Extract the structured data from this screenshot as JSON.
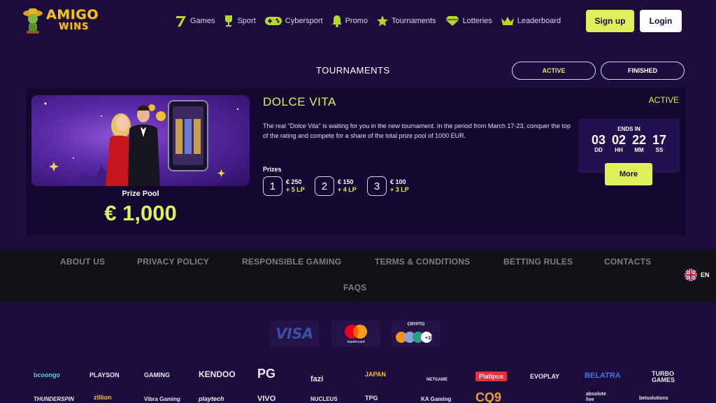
{
  "brand": {
    "logo_top": "AMIGO",
    "logo_bottom": "WINS"
  },
  "nav": [
    {
      "label": "Games",
      "icon": "seven-icon"
    },
    {
      "label": "Sport",
      "icon": "trophy-icon"
    },
    {
      "label": "Cybersport",
      "icon": "gamepad-icon"
    },
    {
      "label": "Promo",
      "icon": "bell-icon"
    },
    {
      "label": "Tournaments",
      "icon": "star-icon"
    },
    {
      "label": "Lotteries",
      "icon": "diamond-icon"
    },
    {
      "label": "Leaderboard",
      "icon": "crown-icon"
    }
  ],
  "auth": {
    "signup": "Sign up",
    "login": "Login"
  },
  "tournaments": {
    "title": "TOURNAMENTS",
    "filters": {
      "active": "ACTIVE",
      "finished": "FINISHED"
    }
  },
  "tournament": {
    "name": "DOLCE VITA",
    "status": "ACTIVE",
    "description": "The real \"Dolce Vita\" is waiting for you in the new tournament. In the period from March 17-23, conquer the top of the rating and compete for a share of the total prize pool of 1000 EUR.",
    "prize_pool_label": "Prize Pool",
    "prize_pool": "€ 1,000",
    "prizes_label": "Prizes",
    "prizes": [
      {
        "rank": "1",
        "amount": "€ 250",
        "lp": "+ 5 LP"
      },
      {
        "rank": "2",
        "amount": "€ 150",
        "lp": "+ 4 LP"
      },
      {
        "rank": "3",
        "amount": "€ 100",
        "lp": "+ 3 LP"
      }
    ],
    "ends_label": "ENDS IN",
    "countdown": [
      {
        "value": "03",
        "unit": "DD"
      },
      {
        "value": "02",
        "unit": "HH"
      },
      {
        "value": "22",
        "unit": "MM"
      },
      {
        "value": "17",
        "unit": "SS"
      }
    ],
    "more": "More"
  },
  "footer": {
    "links": {
      "about": "ABOUT US",
      "privacy": "PRIVACY POLICY",
      "responsible": "RESPONSIBLE GAMING",
      "terms": "TERMS & CONDITIONS",
      "betting": "BETTING RULES",
      "contacts": "CONTACTS",
      "faqs": "FAQS"
    },
    "language": "EN"
  },
  "payments": {
    "visa": "VISA",
    "mastercard": "mastercard",
    "crypto": "CRYPTO",
    "crypto_more": "+10"
  },
  "providers": {
    "row1": [
      "bcoongo",
      "PLAYSON",
      "GAMING",
      "KENDOO",
      "PG",
      "fazi",
      "JAPAN",
      "NETGAME",
      "Platipus",
      "EVOPLAY",
      "BELATRA",
      "TURBO GAMES"
    ],
    "row2": [
      "THUNDERSPIN",
      "zillion",
      "Vibra Gaming",
      "playtech",
      "VIVO",
      "NUCLEUS",
      "TPG",
      "KA Gaming",
      "CQ9",
      "absolute live",
      "betsolutions"
    ]
  },
  "colors": {
    "accent": "#dff05b",
    "background": "#1b0c3d",
    "card": "#130731",
    "footer": "#111015"
  }
}
